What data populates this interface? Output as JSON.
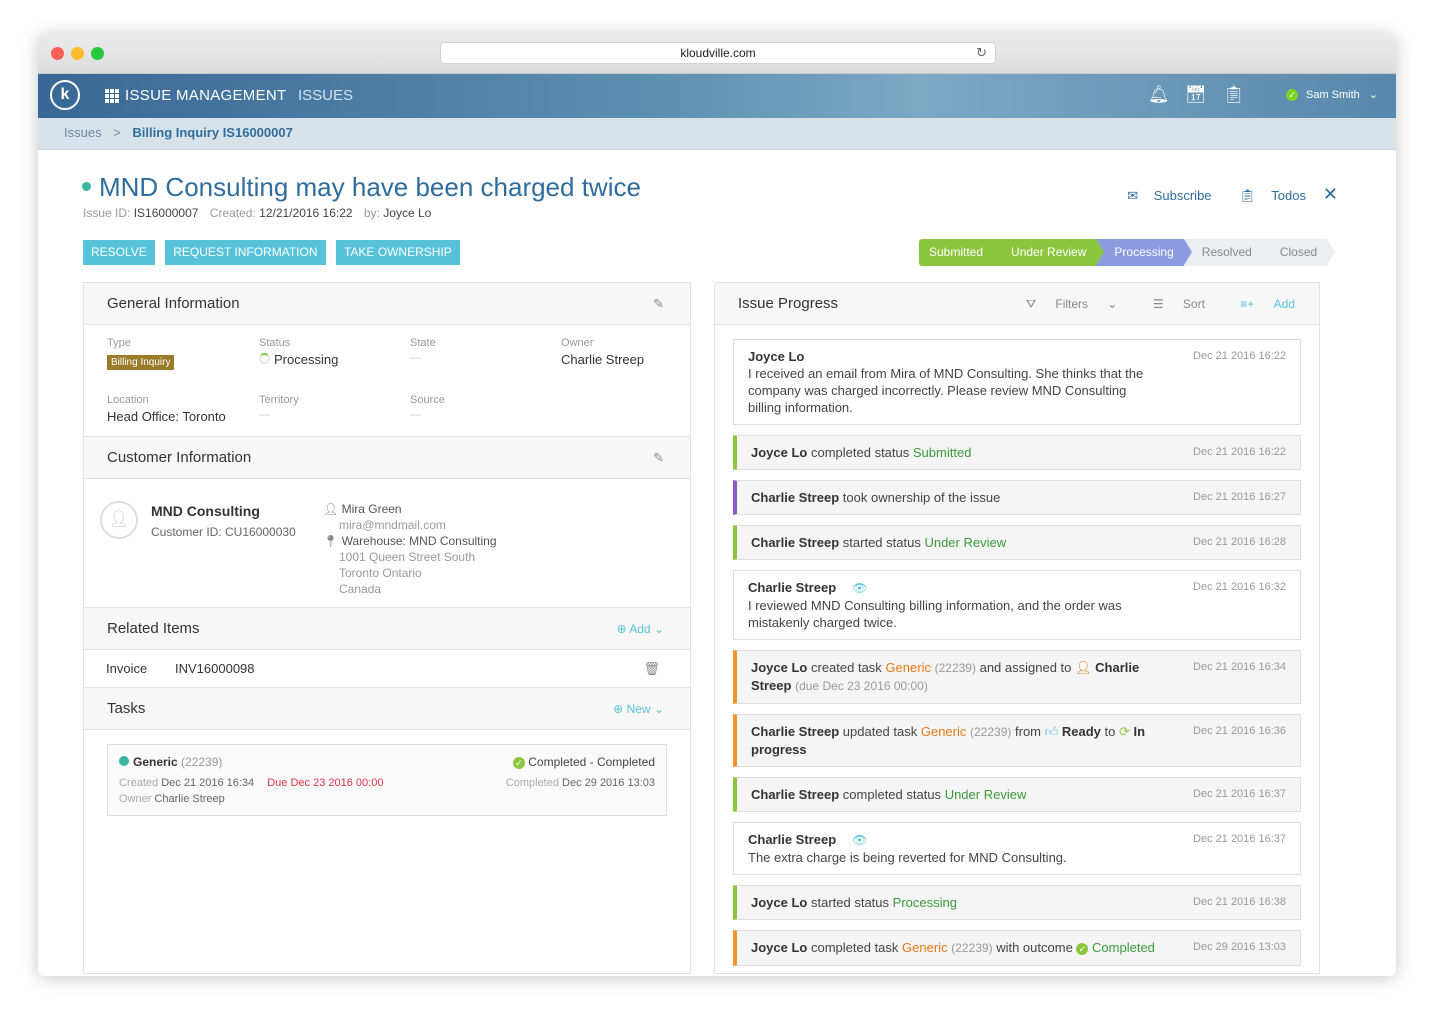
{
  "browser": {
    "url": "kloudville.com"
  },
  "header": {
    "app_title": "ISSUE MANAGEMENT",
    "nav_issues": "ISSUES",
    "user_name": "Sam Smith"
  },
  "breadcrumb": {
    "root": "Issues",
    "separator": ">",
    "current": "Billing Inquiry IS16000007"
  },
  "issue": {
    "title": "MND Consulting may have been charged twice",
    "id_label": "Issue ID:",
    "id": "IS16000007",
    "created_label": "Created:",
    "created": "12/21/2016 16:22",
    "by_label": "by:",
    "by": "Joyce Lo"
  },
  "top_actions": {
    "subscribe": "Subscribe",
    "todos": "Todos"
  },
  "actions": {
    "resolve": "RESOLVE",
    "request_info": "REQUEST INFORMATION",
    "take_ownership": "TAKE OWNERSHIP"
  },
  "steps": [
    "Submitted",
    "Under Review",
    "Processing",
    "Resolved",
    "Closed"
  ],
  "general": {
    "heading": "General Information",
    "type_label": "Type",
    "type": "Billing Inquiry",
    "status_label": "Status",
    "status": "Processing",
    "state_label": "State",
    "state": "—",
    "owner_label": "Owner",
    "owner": "Charlie Streep",
    "location_label": "Location",
    "location": "Head Office: Toronto",
    "territory_label": "Territory",
    "territory": "—",
    "source_label": "Source",
    "source": "—"
  },
  "customer": {
    "heading": "Customer Information",
    "name": "MND Consulting",
    "id_text": "Customer ID: CU16000030",
    "contact_name": "Mira Green",
    "contact_email": "mira@mndmail.com",
    "address_title": "Warehouse: MND Consulting",
    "address_line1": "1001 Queen Street South",
    "address_line2": "Toronto Ontario",
    "address_line3": "Canada"
  },
  "related": {
    "heading": "Related Items",
    "add": "Add",
    "item_type": "Invoice",
    "item_id": "INV16000098"
  },
  "tasks": {
    "heading": "Tasks",
    "new": "New",
    "name": "Generic",
    "num": "(22239)",
    "outcome": "Completed - Completed",
    "created_label": "Created",
    "created": "Dec 21 2016 16:34",
    "due": "Due Dec 23 2016 00:00",
    "completed_label": "Completed",
    "completed": "Dec 29 2016 13:03",
    "owner_label": "Owner",
    "owner": "Charlie Streep"
  },
  "progress": {
    "heading": "Issue Progress",
    "filters": "Filters",
    "sort": "Sort",
    "add": "Add",
    "e1_author": "Joyce Lo",
    "e1_text": "I received an email from Mira of MND Consulting. She thinks that the company was charged incorrectly. Please review MND Consulting billing information.",
    "e1_time": "Dec 21 2016 16:22",
    "e2_author": "Joyce Lo",
    "e2_text": "completed status",
    "e2_status": "Submitted",
    "e2_time": "Dec 21 2016 16:22",
    "e3_author": "Charlie Streep",
    "e3_text": "took ownership of the issue",
    "e3_time": "Dec 21 2016 16:27",
    "e4_author": "Charlie Streep",
    "e4_text": "started status",
    "e4_status": "Under Review",
    "e4_time": "Dec 21 2016 16:28",
    "e5_author": "Charlie Streep",
    "e5_text": "I reviewed MND Consulting billing information, and the order was mistakenly charged twice.",
    "e5_time": "Dec 21 2016 16:32",
    "e6_author": "Joyce Lo",
    "e6_text1": "created task",
    "e6_task": "Generic",
    "e6_num": "(22239)",
    "e6_text2": "and assigned to",
    "e6_assignee": "Charlie Streep",
    "e6_due": "(due Dec 23 2016 00:00)",
    "e6_time": "Dec 21 2016 16:34",
    "e7_author": "Charlie Streep",
    "e7_text1": "updated task",
    "e7_task": "Generic",
    "e7_num": "(22239)",
    "e7_text2": "from",
    "e7_from": "Ready",
    "e7_text3": "to",
    "e7_to": "In progress",
    "e7_time": "Dec 21 2016 16:36",
    "e8_author": "Charlie Streep",
    "e8_text": "completed status",
    "e8_status": "Under Review",
    "e8_time": "Dec 21 2016 16:37",
    "e9_author": "Charlie Streep",
    "e9_text": "The extra charge is being reverted for MND Consulting.",
    "e9_time": "Dec 21 2016 16:37",
    "e10_author": "Joyce Lo",
    "e10_text": "started status",
    "e10_status": "Processing",
    "e10_time": "Dec 21 2016 16:38",
    "e11_author": "Joyce Lo",
    "e11_text1": "completed task",
    "e11_task": "Generic",
    "e11_num": "(22239)",
    "e11_text2": "with outcome",
    "e11_outcome": "Completed",
    "e11_time": "Dec 29 2016 13:03"
  },
  "colors": {
    "accent": "#57c3da",
    "title_blue": "#2f6d9d",
    "green": "#8cc63f",
    "purple": "#8b9be0",
    "orange": "#f5922a"
  }
}
